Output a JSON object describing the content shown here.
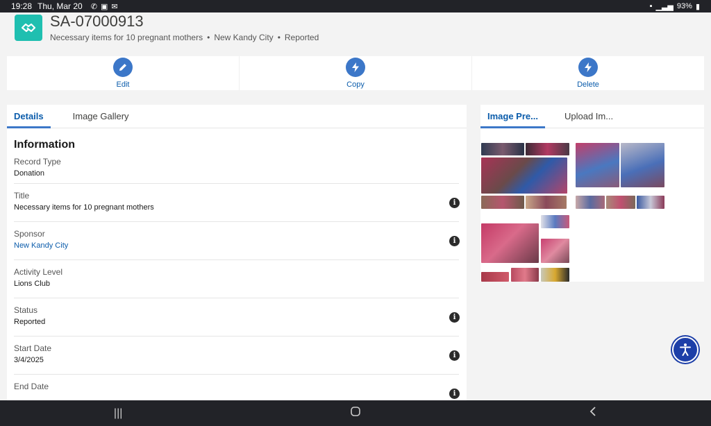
{
  "status_bar": {
    "time": "19:28",
    "date": "Thu, Mar 20",
    "battery": "93%"
  },
  "record": {
    "title": "SA-07000913",
    "subtitle_parts": [
      "Necessary items for 10 pregnant mothers",
      "•",
      "New Kandy City",
      "•",
      "Reported"
    ],
    "icon": "handshake-icon"
  },
  "actions": [
    {
      "label": "Edit",
      "icon": "pencil-icon"
    },
    {
      "label": "Copy",
      "icon": "bolt-icon"
    },
    {
      "label": "Delete",
      "icon": "bolt-icon"
    }
  ],
  "left_tabs": [
    {
      "label": "Details",
      "active": true
    },
    {
      "label": "Image Gallery",
      "active": false
    }
  ],
  "section_title": "Information",
  "fields": [
    {
      "label": "Record Type",
      "value": "Donation",
      "info": false
    },
    {
      "label": "Title",
      "value": "Necessary items for 10 pregnant mothers",
      "info": true
    },
    {
      "label": "Sponsor",
      "value": "New Kandy City",
      "info": true,
      "link": true
    },
    {
      "label": "Activity Level",
      "value": "Lions Club",
      "info": false
    },
    {
      "label": "Status",
      "value": "Reported",
      "info": true
    },
    {
      "label": "Start Date",
      "value": "3/4/2025",
      "info": true
    },
    {
      "label": "End Date",
      "value": "",
      "info": true
    }
  ],
  "right_tabs": [
    {
      "label": "Image Pre...",
      "active": true
    },
    {
      "label": "Upload Im...",
      "active": false
    }
  ],
  "colors": {
    "accent": "#3c77c8",
    "link": "#0b5cab",
    "record_icon": "#1fbfb0",
    "accessibility": "#1d3fa8"
  },
  "nav": {
    "recents": "recents-icon",
    "home": "home-icon",
    "back": "back-icon"
  },
  "accessibility_button": "accessibility-icon"
}
